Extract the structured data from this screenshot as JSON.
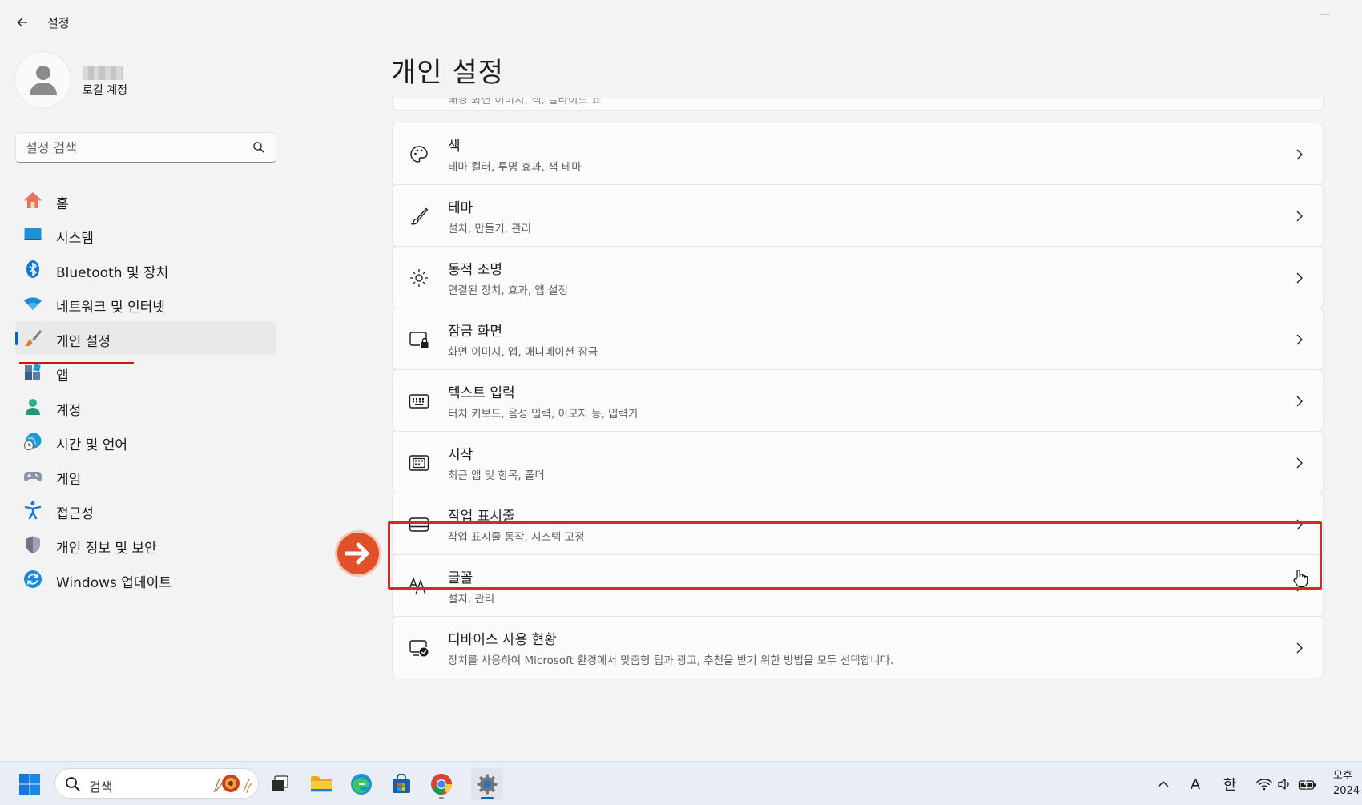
{
  "window": {
    "title": "설정"
  },
  "profile": {
    "subtitle": "로컬 계정"
  },
  "search": {
    "placeholder": "설정 검색"
  },
  "sidebar": {
    "items": [
      {
        "label": "홈",
        "icon": "home-icon"
      },
      {
        "label": "시스템",
        "icon": "system-icon"
      },
      {
        "label": "Bluetooth 및 장치",
        "icon": "bluetooth-icon"
      },
      {
        "label": "네트워크 및 인터넷",
        "icon": "wifi-icon"
      },
      {
        "label": "개인 설정",
        "icon": "brush-icon",
        "selected": true
      },
      {
        "label": "앱",
        "icon": "apps-icon"
      },
      {
        "label": "계정",
        "icon": "account-icon"
      },
      {
        "label": "시간 및 언어",
        "icon": "time-language-icon"
      },
      {
        "label": "게임",
        "icon": "gamepad-icon"
      },
      {
        "label": "접근성",
        "icon": "accessibility-icon"
      },
      {
        "label": "개인 정보 및 보안",
        "icon": "shield-icon"
      },
      {
        "label": "Windows 업데이트",
        "icon": "update-icon"
      }
    ]
  },
  "main": {
    "title": "개인 설정",
    "partial_desc": "배경 화면 이미지, 색, 슬라이드 쇼",
    "cards": [
      {
        "title": "색",
        "desc": "테마 컬러, 투명 효과, 색 테마",
        "icon": "palette-icon"
      },
      {
        "title": "테마",
        "desc": "설치, 만들기, 관리",
        "icon": "brush-icon"
      },
      {
        "title": "동적 조명",
        "desc": "연결된 장치, 효과, 앱 설정",
        "icon": "lighting-icon"
      },
      {
        "title": "잠금 화면",
        "desc": "화면 이미지, 앱, 애니메이션 잠금",
        "icon": "lock-screen-icon"
      },
      {
        "title": "텍스트 입력",
        "desc": "터치 키보드, 음성 입력, 이모지 등, 입력기",
        "icon": "keyboard-icon"
      },
      {
        "title": "시작",
        "desc": "최근 앱 및 항목, 폴더",
        "icon": "start-icon"
      },
      {
        "title": "작업 표시줄",
        "desc": "작업 표시줄 동작, 시스템 고정",
        "icon": "taskbar-icon",
        "highlighted": true
      },
      {
        "title": "글꼴",
        "desc": "설치, 관리",
        "icon": "font-icon"
      },
      {
        "title": "디바이스 사용 현황",
        "desc": "장치를 사용하여 Microsoft 환경에서 맞춤형 팁과 광고, 추천을 받기 위한 방법을 모두 선택합니다.",
        "icon": "device-usage-icon"
      }
    ]
  },
  "taskbar": {
    "search_label": "검색",
    "ime_label": "A",
    "ime_mode": "한",
    "clock_time": "오후",
    "clock_date": "2024-"
  },
  "colors": {
    "accent": "#0067c0",
    "highlight": "#d42a2a",
    "arrow": "#e0502a"
  }
}
